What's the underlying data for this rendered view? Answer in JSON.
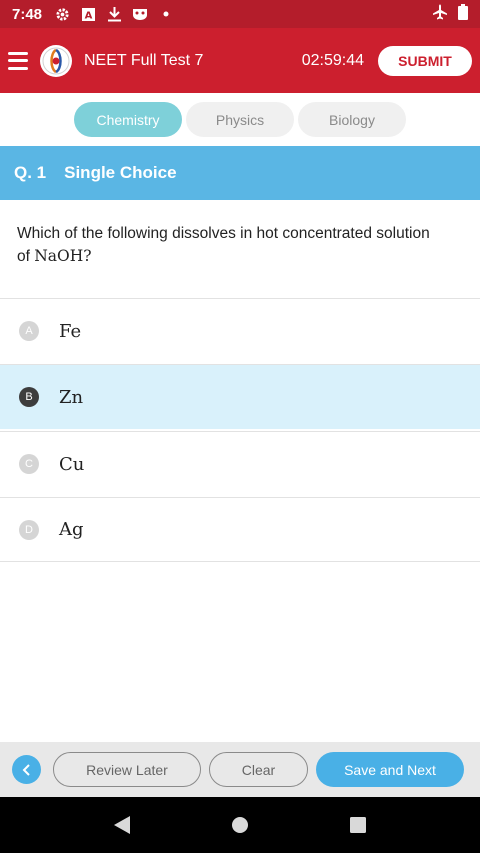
{
  "status_bar": {
    "time": "7:48",
    "icons": [
      "gear-icon",
      "a-box-icon",
      "download-icon",
      "game-icon",
      "dot-icon"
    ],
    "right_icons": [
      "airplane-icon",
      "battery-icon"
    ]
  },
  "app_bar": {
    "title": "NEET Full Test 7",
    "timer": "02:59:44",
    "submit_label": "SUBMIT"
  },
  "tabs": [
    {
      "label": "Chemistry",
      "active": true
    },
    {
      "label": "Physics",
      "active": false
    },
    {
      "label": "Biology",
      "active": false
    }
  ],
  "question": {
    "number": "Q. 1",
    "type": "Single Choice",
    "text_line1": "Which of the following dissolves in hot concentrated solution",
    "text_line2_prefix": "of ",
    "text_formula": "NaOH",
    "text_suffix": "?"
  },
  "options": [
    {
      "letter": "A",
      "text": "Fe",
      "selected": false
    },
    {
      "letter": "B",
      "text": "Zn",
      "selected": true
    },
    {
      "letter": "C",
      "text": "Cu",
      "selected": false
    },
    {
      "letter": "D",
      "text": "Ag",
      "selected": false
    }
  ],
  "bottom_bar": {
    "review_label": "Review Later",
    "clear_label": "Clear",
    "save_label": "Save and Next"
  },
  "colors": {
    "status_bar": "#b41d2b",
    "app_bar": "#cc1f2e",
    "tab_active": "#7ed0d9",
    "question_header": "#5ab6e4",
    "selected_option": "#d9f1fb",
    "primary_button": "#49b0e6"
  }
}
